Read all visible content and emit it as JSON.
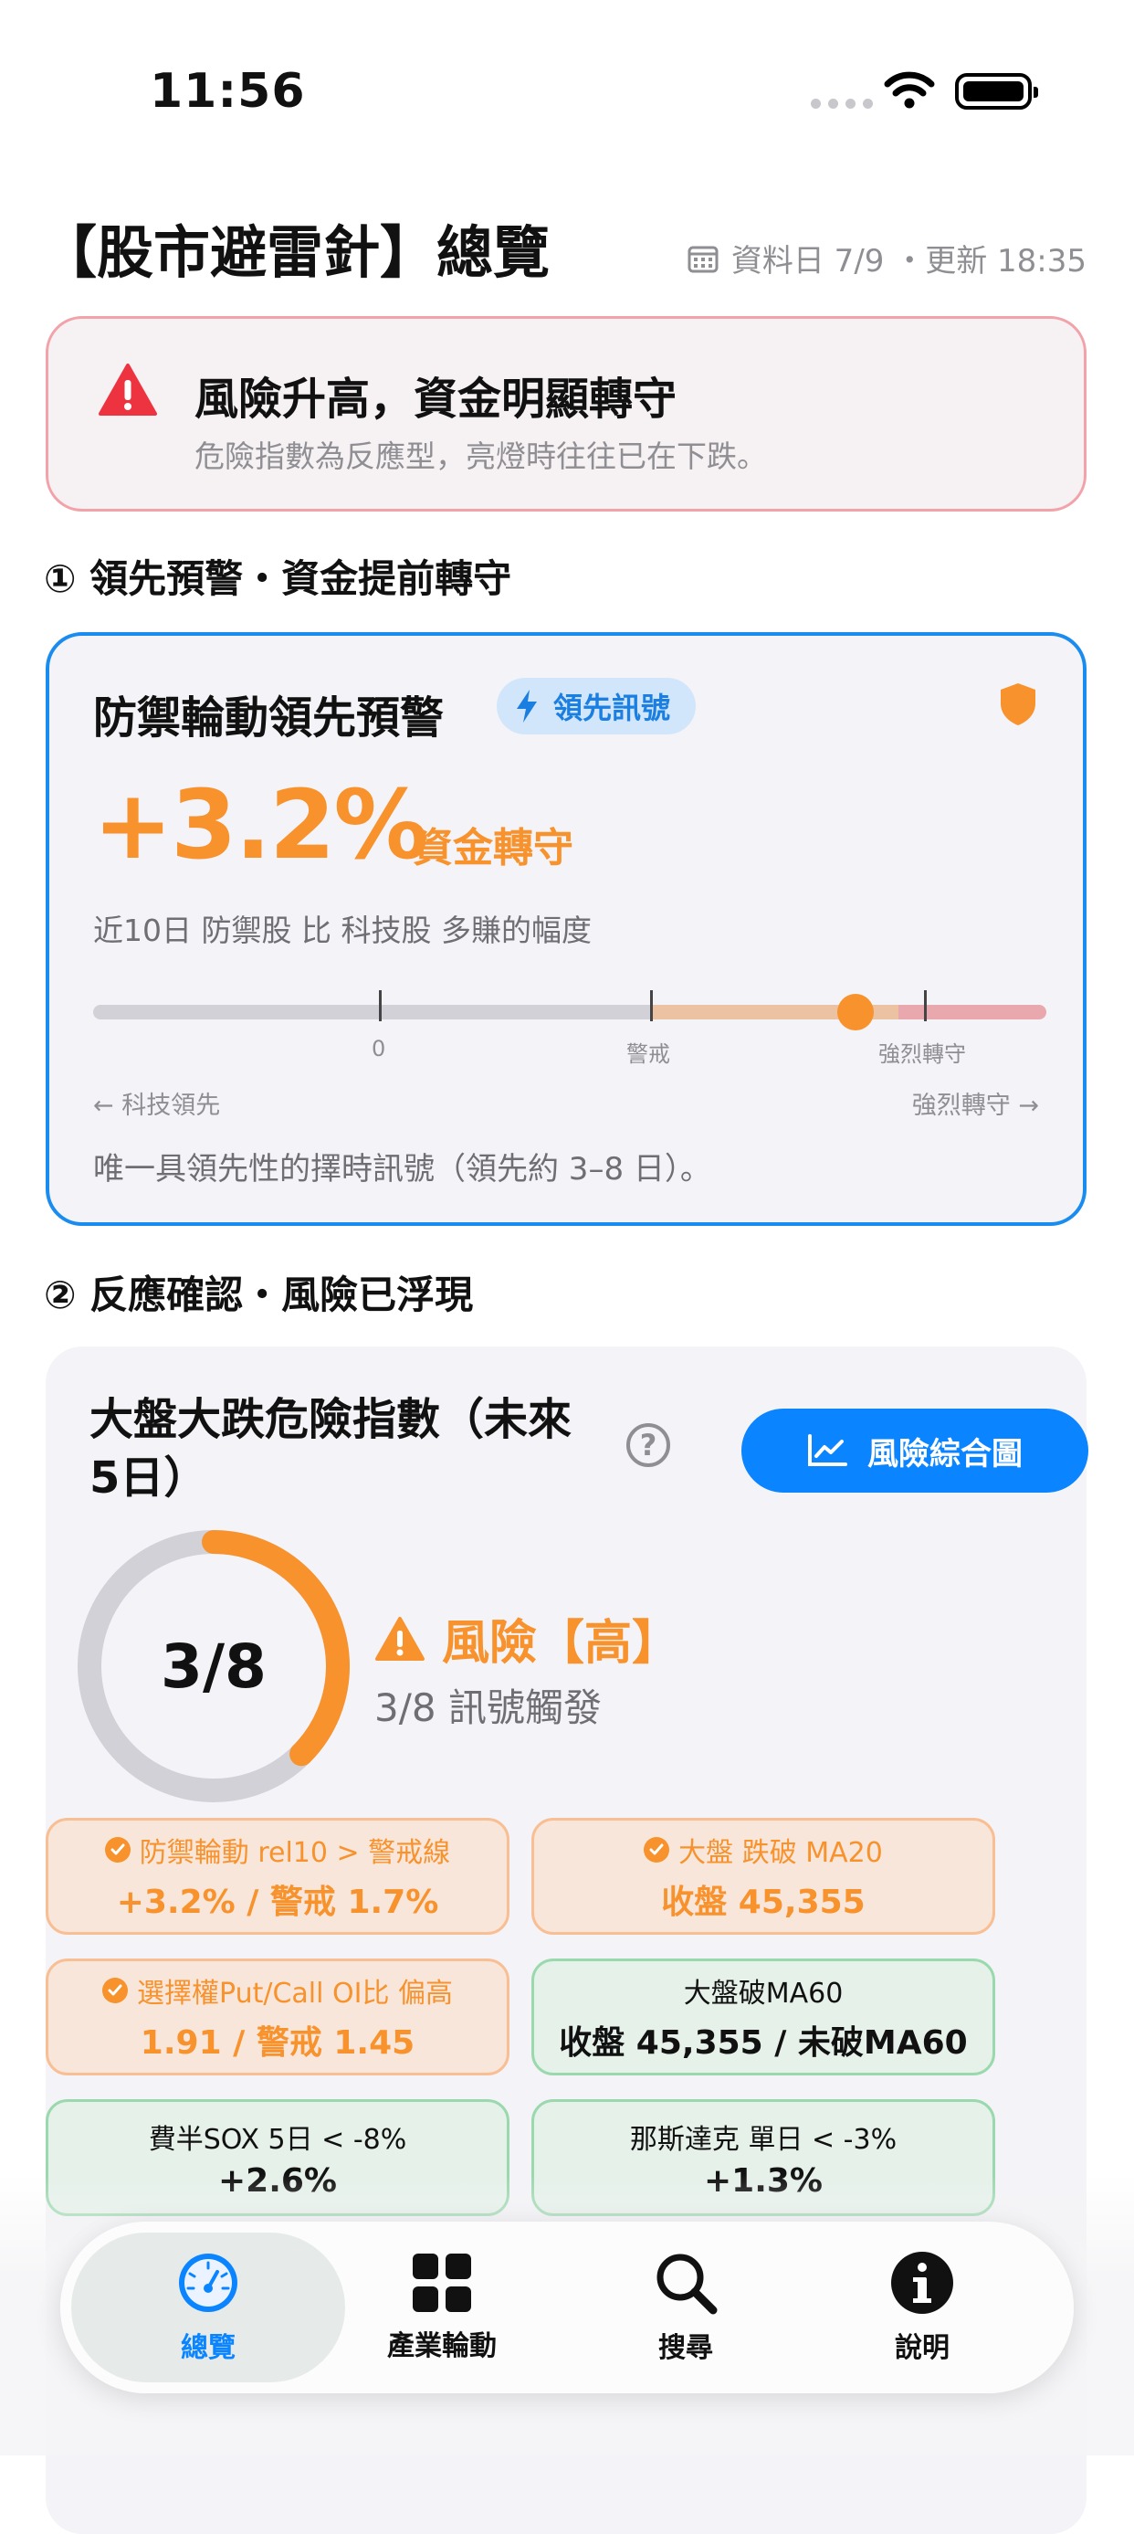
{
  "status": {
    "time": "11:56"
  },
  "header": {
    "title": "【股市避雷針】總覽",
    "meta": "資料日 7/9 ・更新 18:35"
  },
  "alert": {
    "headline": "風險升高，資金明顯轉守",
    "sub": "危險指數為反應型，亮燈時往往已在下跌。"
  },
  "section1": {
    "title": "① 領先預警・資金提前轉守"
  },
  "lead": {
    "title": "防禦輪動領先預警",
    "pill": "領先訊號",
    "value": "+3.2%",
    "tag": "資金轉守",
    "desc": "近10日 防禦股 比 科技股 多賺的幅度",
    "gauge_position": 0.8,
    "ticks": {
      "zero": "0",
      "warn": "警戒",
      "strong": "強烈轉守"
    },
    "left_hint": "← 科技領先",
    "right_hint": "強烈轉守 →",
    "footer": "唯一具領先性的擇時訊號（領先約 3–8 日）。",
    "colors": {
      "accent": "#f7922d",
      "border": "#1a8cf0"
    }
  },
  "section2": {
    "title": "② 反應確認・風險已浮現"
  },
  "danger": {
    "title": "大盤大跌危險指數（未來5日）",
    "help": "?",
    "chart_button": "風險綜合圖",
    "score": "3/8",
    "score_fraction": 0.375,
    "level": "風險【高】",
    "triggered": "3/8 訊號觸發",
    "signals": [
      {
        "label": "防禦輪動 rel10 > 警戒線",
        "value": "+3.2% / 警戒 1.7%",
        "on": true
      },
      {
        "label": "大盤 跌破 MA20",
        "value": "收盤 45,355",
        "on": true
      },
      {
        "label": "選擇權Put/Call OI比 偏高",
        "value": "1.91 / 警戒 1.45",
        "on": true
      },
      {
        "label": "大盤破MA60",
        "value": "收盤 45,355 / 未破MA60",
        "on": false
      },
      {
        "label": "費半SOX 5日 < -8%",
        "value": "+2.6%",
        "on": false
      },
      {
        "label": "那斯達克 單日 < -3%",
        "value": "+1.3%",
        "on": false
      }
    ]
  },
  "tabs": [
    {
      "label": "總覽",
      "icon": "gauge-icon",
      "active": true
    },
    {
      "label": "產業輪動",
      "icon": "grid-icon",
      "active": false
    },
    {
      "label": "搜尋",
      "icon": "search-icon",
      "active": false
    },
    {
      "label": "說明",
      "icon": "info-icon",
      "active": false
    }
  ]
}
